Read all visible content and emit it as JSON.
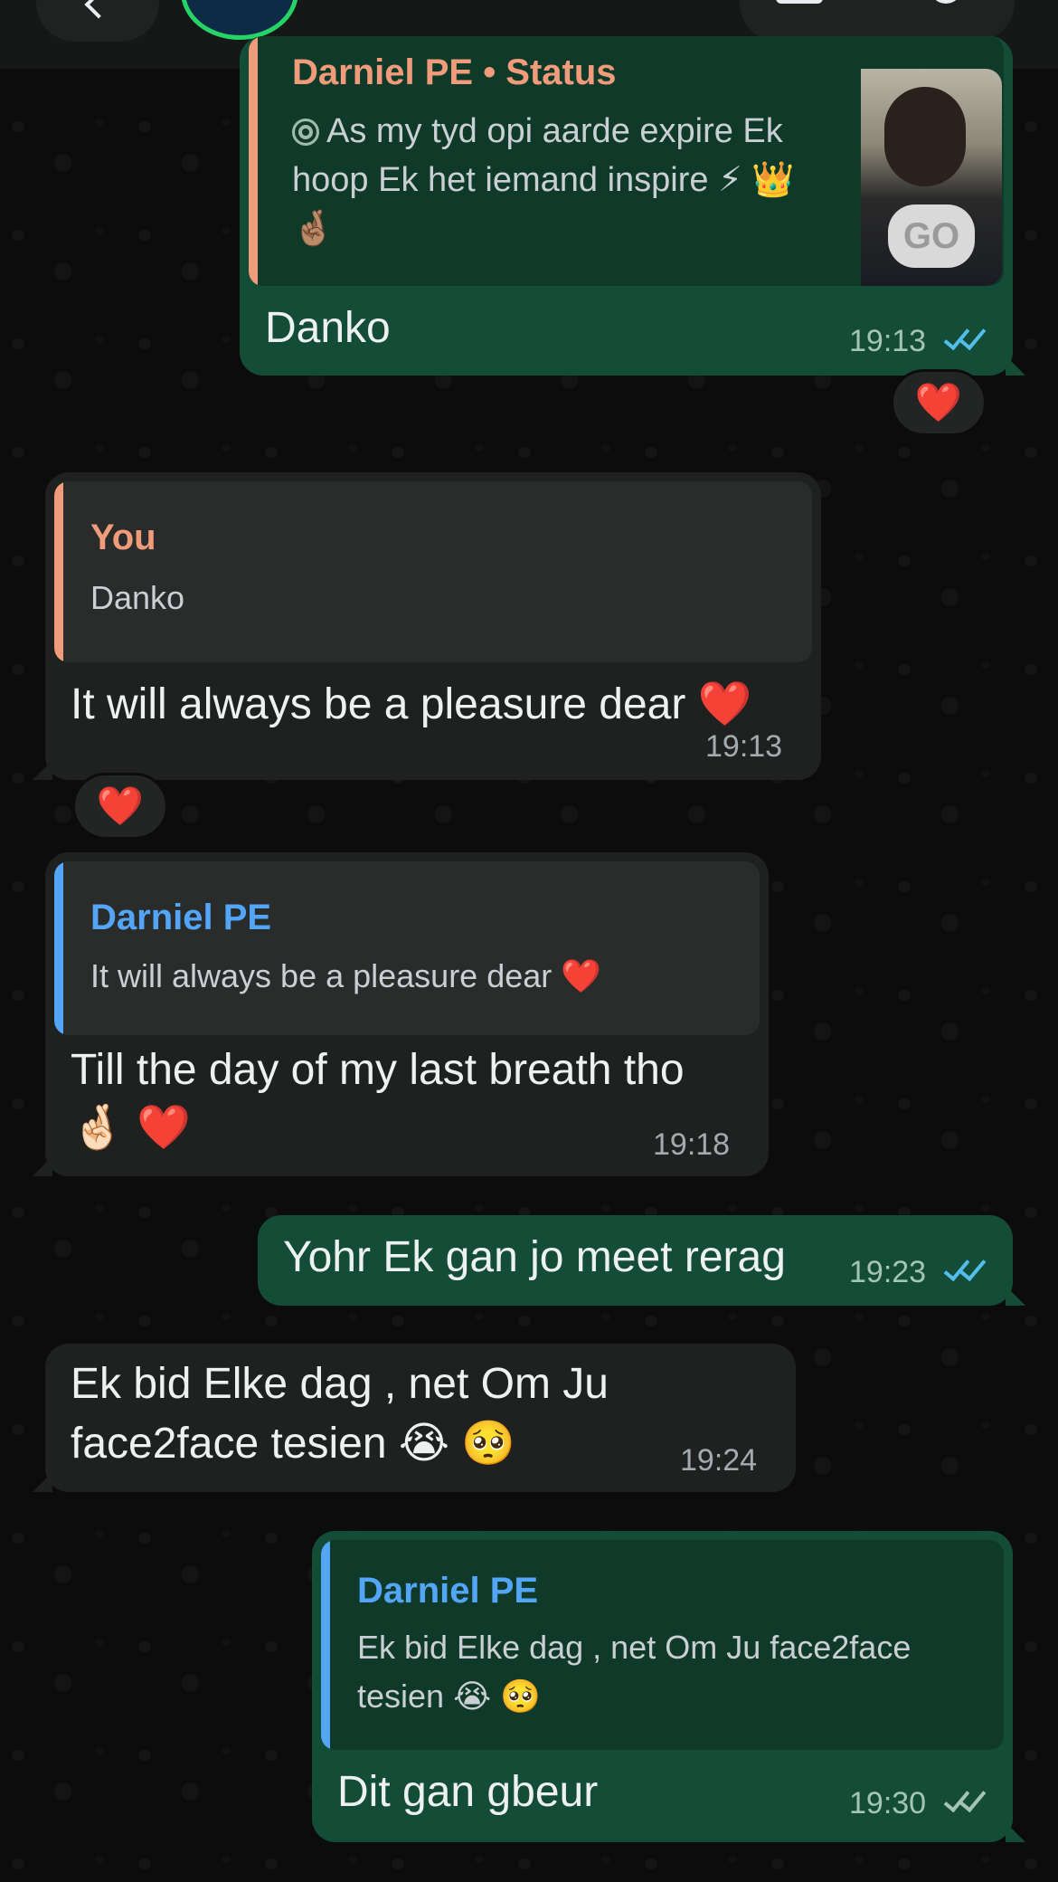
{
  "colors": {
    "incoming_bubble": "#1f2020",
    "outgoing_bubble": "#144d37",
    "quote_author_self": "#f09c7a",
    "quote_author_contact": "#53a6f7",
    "read_ticks": "#53bdeb"
  },
  "header": {
    "back_icon": "chevron-left-icon",
    "video_icon": "video-call-icon",
    "phone_icon": "phone-call-icon"
  },
  "messages": [
    {
      "direction": "out",
      "quote_author": "Darniel PE • Status",
      "quote_text_1": "As my tyd opi aarde expire Ek",
      "quote_text_2": "hoop Ek het iemand inspire ⚡ 👑",
      "quote_text_3": "🤞🏽",
      "text": "Danko",
      "time": "19:13",
      "reaction": "❤️",
      "status": "read"
    },
    {
      "direction": "in",
      "quote_author": "You",
      "quote_text": "Danko",
      "text": "It will always be a pleasure dear ❤️",
      "time": "19:13",
      "reaction": "❤️"
    },
    {
      "direction": "in",
      "quote_author": "Darniel PE",
      "quote_text": "It will always be a pleasure dear ❤️",
      "text_line1": "Till the day of my last breath tho",
      "text_line2": "🤞🏻 ❤️",
      "time": "19:18"
    },
    {
      "direction": "out",
      "text": "Yohr Ek gan jo meet rerag",
      "time": "19:23",
      "status": "read"
    },
    {
      "direction": "in",
      "text_line1": "Ek bid Elke dag , net Om Ju",
      "text_line2": "face2face tesien 😭 🥺",
      "time": "19:24"
    },
    {
      "direction": "out",
      "quote_author": "Darniel PE",
      "quote_text_1": "Ek bid Elke dag , net Om Ju face2face",
      "quote_text_2": "tesien 😭 🥺",
      "text": "Dit gan gbeur",
      "time": "19:30",
      "status": "delivered"
    }
  ]
}
